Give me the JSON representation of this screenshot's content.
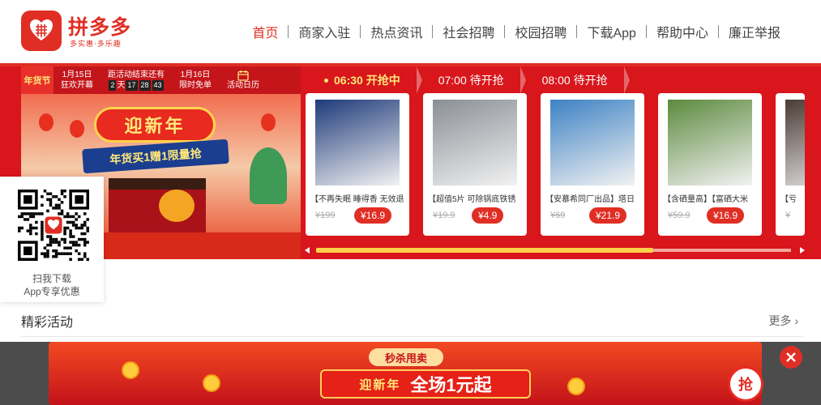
{
  "header": {
    "brand": "拼多多",
    "brand_sub": "多实惠·多乐趣",
    "nav": [
      "首页",
      "商家入驻",
      "热点资讯",
      "社会招聘",
      "校园招聘",
      "下载App",
      "帮助中心",
      "廉正举报"
    ],
    "active_nav": "首页"
  },
  "festival": {
    "badge": "年货节",
    "cells": [
      {
        "date": "1月15日",
        "text": "狂欢开幕"
      },
      {
        "date": "距活动结束还有",
        "countdown": [
          "2",
          "天",
          "17",
          "28",
          "43"
        ]
      },
      {
        "date": "1月16日",
        "text": "限时免单"
      }
    ],
    "calendar_label": "活动日历",
    "title": "迎新年",
    "ribbon": "年货买1赠1限量抢"
  },
  "flash": {
    "tabs": [
      {
        "label": "06:30 开抢中",
        "active": true
      },
      {
        "label": "07:00 待开抢",
        "active": false
      },
      {
        "label": "08:00 待开抢",
        "active": false
      }
    ],
    "products": [
      {
        "name": "【不再失眠 睡得香 无效退",
        "old_price": "¥199",
        "price": "¥16.9",
        "color": "#1e3a7a"
      },
      {
        "name": "【超值5片 可除锅底铁锈",
        "old_price": "¥19.9",
        "price": "¥4.9",
        "color": "#8a8f96"
      },
      {
        "name": "【安慕希同厂出品】塔日",
        "old_price": "¥69",
        "price": "¥21.9",
        "color": "#3d82c4"
      },
      {
        "name": "【含硒量高】【富硒大米",
        "old_price": "¥59.9",
        "price": "¥16.9",
        "color": "#5c8a3e"
      },
      {
        "name": "【亏",
        "old_price": "¥",
        "price": "",
        "color": "#4a3b35"
      }
    ]
  },
  "qr": {
    "line1": "扫我下载",
    "line2": "App专享优惠"
  },
  "section": {
    "title": "精彩活动",
    "more": "更多"
  },
  "promo": {
    "tag": "秒杀甩卖",
    "left": "迎新年",
    "right": "全场1元起",
    "grab": "抢"
  },
  "colors": {
    "brand": "#e02e24",
    "banner": "#d8161b",
    "gold": "#ffe77a"
  }
}
